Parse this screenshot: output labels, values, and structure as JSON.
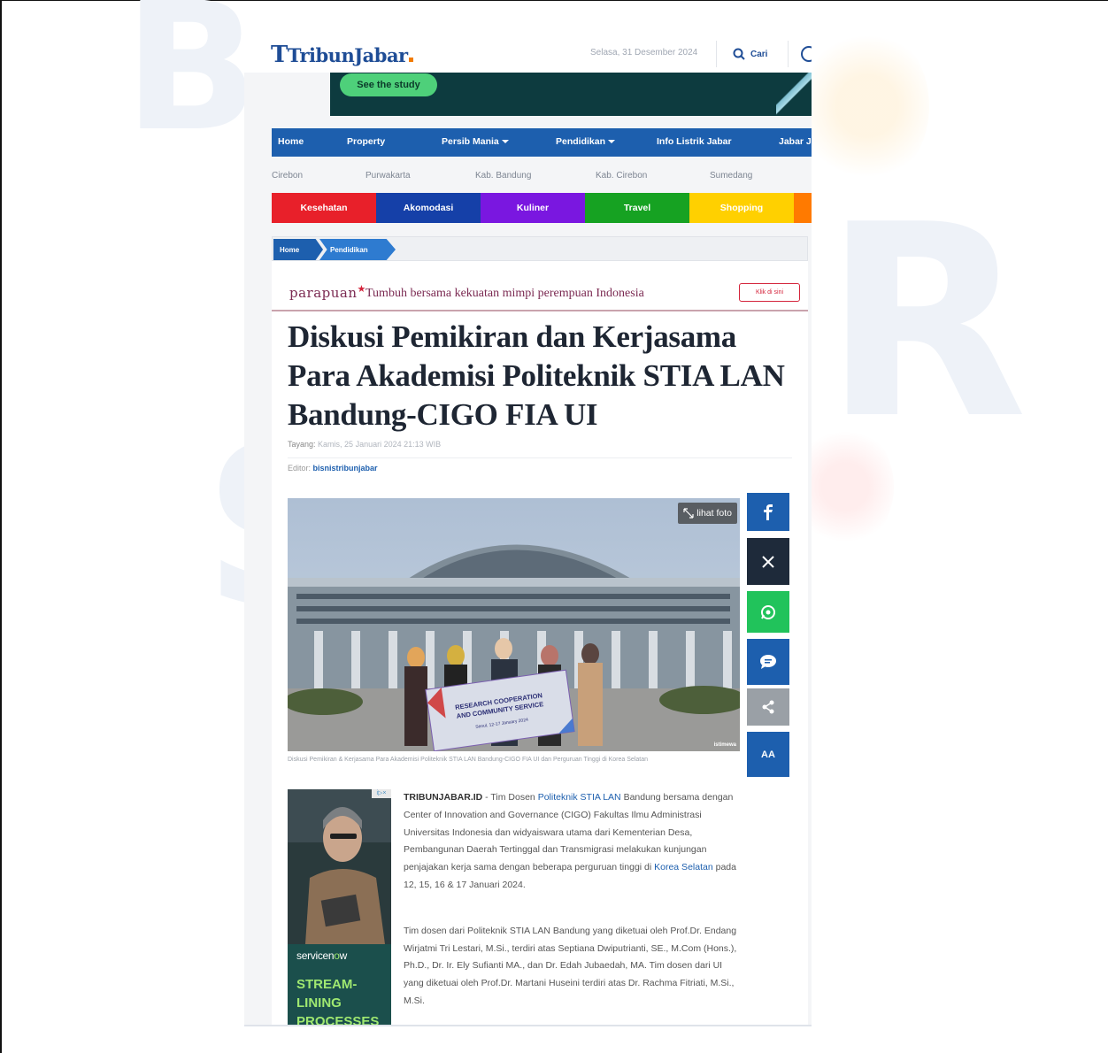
{
  "header": {
    "logo_text": "TribunJabar",
    "date": "Selasa, 31 Desember 2024",
    "search_label": "Cari"
  },
  "ad_banner": {
    "cta": "See the study"
  },
  "main_nav": [
    {
      "label": "Home",
      "dropdown": false
    },
    {
      "label": "Property",
      "dropdown": false
    },
    {
      "label": "Persib Mania",
      "dropdown": true
    },
    {
      "label": "Pendidikan",
      "dropdown": true
    },
    {
      "label": "Info Listrik Jabar",
      "dropdown": false
    },
    {
      "label": "Jabar J",
      "dropdown": false
    }
  ],
  "sub_nav": [
    "Cirebon",
    "Purwakarta",
    "Kab. Bandung",
    "Kab. Cirebon",
    "Sumedang"
  ],
  "category_nav": [
    {
      "label": "Kesehatan",
      "color": "#e8202a"
    },
    {
      "label": "Akomodasi",
      "color": "#1540a8"
    },
    {
      "label": "Kuliner",
      "color": "#7a17e0"
    },
    {
      "label": "Travel",
      "color": "#16a222"
    },
    {
      "label": "Shopping",
      "color": "#ffd000"
    },
    {
      "label": "",
      "color": "#ff7a00"
    }
  ],
  "breadcrumb": [
    "Home",
    "Pendidikan"
  ],
  "parapuan": {
    "logo": "parapuan",
    "tagline": "Tumbuh bersama kekuatan mimpi perempuan Indonesia",
    "button": "Klik di sini"
  },
  "article": {
    "title": "Diskusi Pemikiran dan Kerjasama Para Akademisi Politeknik STIA LAN Bandung-CIGO FIA UI",
    "published_label": "Tayang:",
    "published_value": "Kamis, 25 Januari 2024 21:13 WIB",
    "editor_label": "Editor:",
    "editor_name": "bisnistribunjabar",
    "photo_button": "lihat foto",
    "photo_banner_line1": "RESEARCH COOPERATION",
    "photo_banner_line2": "AND COMMUNITY SERVICE",
    "photo_banner_line3": "Seoul, 12-17 January 2024",
    "photo_watermark": "istimewa",
    "caption": "Diskusi Pemikiran & Kerjasama Para Akademisi Politeknik STIA LAN Bandung-CIGO FIA UI dan Perguruan Tinggi di Korea Selatan",
    "para1_lead": "TRIBUNJABAR.ID",
    "para1_a": " - Tim Dosen ",
    "para1_link1": "Politeknik STIA LAN",
    "para1_b": " Bandung bersama dengan Center of Innovation and Governance (CIGO) Fakultas Ilmu Administrasi Universitas Indonesia dan widyaiswara utama dari Kementerian Desa, Pembangunan Daerah Tertinggal dan Transmigrasi melakukan kunjungan penjajakan kerja sama dengan beberapa perguruan tinggi di ",
    "para1_link2": "Korea Selatan",
    "para1_c": " pada 12, 15, 16 & 17 Januari 2024.",
    "para2": "Tim dosen dari Politeknik STIA LAN Bandung yang diketuai oleh Prof.Dr. Endang Wirjatmi Tri Lestari, M.Si., terdiri atas Septiana Dwiputrianti, SE., M.Com (Hons.), Ph.D., Dr. Ir. Ely Sufianti MA., dan Dr. Edah Jubaedah, MA. Tim dosen dari UI yang diketuai oleh Prof.Dr. Martani Huseini terdiri atas Dr. Rachma Fitriati, M.Si., M.Si."
  },
  "share_buttons": [
    {
      "name": "facebook",
      "color": "#1d5fae"
    },
    {
      "name": "x",
      "color": "#1e2a3a"
    },
    {
      "name": "whatsapp",
      "color": "#21c35b"
    },
    {
      "name": "comment",
      "color": "#1d5fae"
    },
    {
      "name": "share",
      "color": "#9aa0a6"
    },
    {
      "name": "font-size",
      "color": "#1d5fae",
      "label": "AA"
    }
  ],
  "side_ad": {
    "brand_a": "servicen",
    "brand_b": "o",
    "brand_c": "w",
    "headline_1": "STREAM-",
    "headline_2": "LINING",
    "headline_3": "PROCESSES"
  }
}
